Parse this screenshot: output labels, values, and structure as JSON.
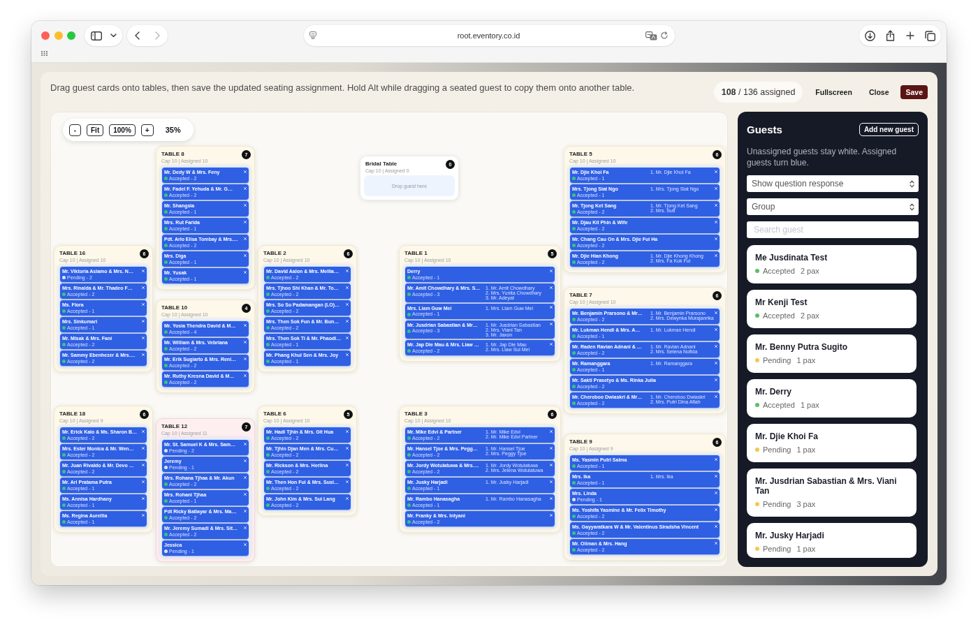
{
  "browser": {
    "url": "root.eventory.co.id"
  },
  "header": {
    "instructions": "Drag guest cards onto tables, then save the updated seating assignment. Hold Alt while dragging a seated guest to copy them onto another table.",
    "assigned": "**108** / 136 assigned",
    "fullscreen": "Fullscreen",
    "close": "Close",
    "save": "Save"
  },
  "canvas": {
    "zoom_out": "-",
    "fit": "Fit",
    "reset_zoom": "100%",
    "zoom_in": "+",
    "zoom_level": "35%",
    "tables": [
      {
        "name": "TABLE 8",
        "info": "Cap 10 | Assigned 10",
        "count": "7",
        "over_capacity": false,
        "guests": [
          {
            "name": "Mr. Dedy W & Mrs. Feny",
            "status": "Accepted - 2",
            "color": "#34c77b"
          },
          {
            "name": "Mr. Fadel F. Yehuda & Mr. G…",
            "status": "Accepted - 2",
            "color": "#34c77b"
          },
          {
            "name": "Mr. Shangsia",
            "status": "Accepted - 1",
            "color": "#34c77b"
          },
          {
            "name": "Mrs. Rut Farida",
            "status": "Accepted - 1",
            "color": "#34c77b"
          },
          {
            "name": "Pdt. Arlo Elisa Tombay & Mrs.…",
            "status": "Accepted - 2",
            "color": "#34c77b"
          },
          {
            "name": "Mrs. Diga",
            "status": "Accepted - 1",
            "color": "#34c77b"
          },
          {
            "name": "Mr. Yusak",
            "status": "Accepted - 1",
            "color": "#34c77b"
          }
        ]
      },
      {
        "name": "Bridal Table",
        "info": "Cap 10 | Assigned 0",
        "count": "0",
        "over_capacity": false,
        "drop_hint": "Drop guest here"
      },
      {
        "name": "TABLE 5",
        "info": "Cap 10 | Assigned 10",
        "count": "6",
        "over_capacity": false,
        "guests": [
          {
            "name": "Mr. Djie Khoi Fa",
            "status": "Accepted - 1",
            "color": "#34c77b",
            "members": [
              "1. Mr. Djie Khoi Fa"
            ]
          },
          {
            "name": "Mrs. Tjong Siat Ngo",
            "status": "Accepted - 1",
            "color": "#34c77b",
            "members": [
              "1. Mrs. Tjong Siat Ngo"
            ]
          },
          {
            "name": "Mr. Tjong Ket Sang",
            "status": "Accepted - 2",
            "color": "#34c77b",
            "members": [
              "1. Mr. Tjong Ket Sang",
              "2. Mrs. Sufi"
            ]
          },
          {
            "name": "Mr. Djau Kit Phin & Wife",
            "status": "Accepted - 2",
            "color": "#34c77b"
          },
          {
            "name": "Mr. Chang Cau On & Mrs. Djie Fui Ha",
            "status": "Accepted - 2",
            "color": "#34c77b"
          },
          {
            "name": "Mr. Djie Hian Khong",
            "status": "Accepted - 2",
            "color": "#34c77b",
            "members": [
              "1. Mr. Djie Khong Khong",
              "2. Mrs. Fa Kok Fui"
            ]
          }
        ]
      },
      {
        "name": "TABLE 16",
        "info": "Cap 10 | Assigned 10",
        "count": "6",
        "over_capacity": false,
        "guests": [
          {
            "name": "Mr. Viktoria Asiamo & Mrs. N…",
            "status": "Pending - 2",
            "color": "#dfe3ea"
          },
          {
            "name": "Mrs. Rinalda & Mr. Thadeo F…",
            "status": "Accepted - 2",
            "color": "#34c77b"
          },
          {
            "name": "Ms. Flora",
            "status": "Accepted - 1",
            "color": "#34c77b"
          },
          {
            "name": "Mrs. Sinkumari",
            "status": "Accepted - 1",
            "color": "#34c77b"
          },
          {
            "name": "Mr. Misak & Mrs. Fani",
            "status": "Accepted - 2",
            "color": "#34c77b"
          },
          {
            "name": "Mr. Sammy Ebenhezer & Mrs.…",
            "status": "Accepted - 2",
            "color": "#34c77b"
          }
        ]
      },
      {
        "name": "TABLE 2",
        "info": "Cap 10 | Assigned 10",
        "count": "6",
        "over_capacity": false,
        "guests": [
          {
            "name": "Mr. David Aalon & Mrs. Mellia…",
            "status": "Accepted - 2",
            "color": "#34c77b"
          },
          {
            "name": "Mrs. Tjhoo Shi Khan & Mr. To…",
            "status": "Accepted - 2",
            "color": "#34c77b"
          },
          {
            "name": "Mrs. So So Padamangan (LO)…",
            "status": "Accepted - 2",
            "color": "#34c77b"
          },
          {
            "name": "Mrs. Then Sok Fun & Mr. Bun…",
            "status": "Accepted - 2",
            "color": "#34c77b"
          },
          {
            "name": "Mrs. Then Sok Ti & Mr. Phaodi…",
            "status": "Accepted - 1",
            "color": "#34c77b"
          },
          {
            "name": "Mr. Phang Khui Sen & Mrs. Joy",
            "status": "Accepted - 1",
            "color": "#34c77b"
          }
        ]
      },
      {
        "name": "TABLE 1",
        "info": "Cap 10 | Assigned 10",
        "count": "5",
        "over_capacity": false,
        "guests": [
          {
            "name": "Derry",
            "status": "Accepted - 1",
            "color": "#34c77b"
          },
          {
            "name": "Mr. Amit Chowdhary & Mrs. S…",
            "status": "Accepted - 3",
            "color": "#34c77b",
            "members": [
              "1. Mr. Amit Chowdhary",
              "2. Mrs. Yunita Chowdhary",
              "3. Mr. Adeyat"
            ]
          },
          {
            "name": "Mrs. Liam Guw Mei",
            "status": "Accepted - 1",
            "color": "#34c77b",
            "members": [
              "1. Mrs. Liam Guw Mei"
            ]
          },
          {
            "name": "Mr. Jusdrian Sabastian & Mr…",
            "status": "Accepted - 3",
            "color": "#34c77b",
            "members": [
              "1. Mr. Jusdrian Sabastian",
              "2. Mrs. Viani Tan",
              "3. Mr. Jaxon"
            ]
          },
          {
            "name": "Mr. Jap Die Mau & Mrs. Liaw …",
            "status": "Accepted - 2",
            "color": "#34c77b",
            "members": [
              "1. Mr. Jap Die Mau",
              "2. Mrs. Liaw Sui Mei"
            ]
          }
        ]
      },
      {
        "name": "TABLE 10",
        "info": "Cap 10 | Assigned 10",
        "count": "4",
        "over_capacity": false,
        "guests": [
          {
            "name": "Mr. Yosia Thendra David & M…",
            "status": "Accepted - 4",
            "color": "#34c77b"
          },
          {
            "name": "Mr. William & Mrs. Vebriana",
            "status": "Accepted - 2",
            "color": "#34c77b"
          },
          {
            "name": "Mr. Erik Sugiarto & Mrs. Reni…",
            "status": "Accepted - 2",
            "color": "#34c77b"
          },
          {
            "name": "Mr. Ruthy Kresna David & M…",
            "status": "Accepted - 2",
            "color": "#34c77b"
          }
        ]
      },
      {
        "name": "TABLE 7",
        "info": "Cap 10 | Assigned 10",
        "count": "6",
        "over_capacity": false,
        "guests": [
          {
            "name": "Mr. Benjamin Prarsono & Mr…",
            "status": "Accepted - 2",
            "color": "#34c77b",
            "members": [
              "1. Mr. Benjamin Prarsono",
              "2. Mrs. Dewynka Murajanrika"
            ]
          },
          {
            "name": "Mr. Lukman Hendi & Mrs. A…",
            "status": "Accepted - 1",
            "color": "#34c77b",
            "members": [
              "1. Mr. Lukman Hendi"
            ]
          },
          {
            "name": "Mr. Raden Ravian Adnani & …",
            "status": "Accepted - 2",
            "color": "#34c77b",
            "members": [
              "1. Mr. Ravian Adnani",
              "2. Mrs. Selena Nofida"
            ]
          },
          {
            "name": "Mr. Ramanggara",
            "status": "Accepted - 1",
            "color": "#34c77b",
            "members": [
              "1. Mr. Ramanggara"
            ]
          },
          {
            "name": "Mr. Sakti Prasetyo & Ms. Rinka Julia",
            "status": "Accepted - 2",
            "color": "#34c77b"
          },
          {
            "name": "Mr. Cheroboo Dwiaskri & Mr…",
            "status": "Accepted - 2",
            "color": "#34c77b",
            "members": [
              "1. Mr. Cheroboo Dwiaskri",
              "2. Mrs. Putri Dina Aflah"
            ]
          }
        ]
      },
      {
        "name": "TABLE 18",
        "info": "Cap 10 | Assigned 9",
        "count": "6",
        "over_capacity": false,
        "guests": [
          {
            "name": "Mr. Erick Kalo & Ms. Sharon B…",
            "status": "Accepted - 2",
            "color": "#34c77b"
          },
          {
            "name": "Mrs. Ester Monica & Mr. Wen…",
            "status": "Accepted - 2",
            "color": "#34c77b"
          },
          {
            "name": "Mr. Juan Rivaldo & Mr. Devo …",
            "status": "Accepted - 2",
            "color": "#34c77b"
          },
          {
            "name": "Mr. Ari Pratama Putra",
            "status": "Accepted - 1",
            "color": "#34c77b"
          },
          {
            "name": "Ms. Annisa Hardhany",
            "status": "Accepted - 1",
            "color": "#34c77b"
          },
          {
            "name": "Ms. Regina Aurellia",
            "status": "Accepted - 1",
            "color": "#34c77b"
          }
        ]
      },
      {
        "name": "TABLE 6",
        "info": "Cap 10 | Assigned 10",
        "count": "5",
        "over_capacity": false,
        "guests": [
          {
            "name": "Mr. Hadi Tjhin & Mrs. Git Hua",
            "status": "Accepted - 2",
            "color": "#34c77b"
          },
          {
            "name": "Mr. Tjhin Djan Men & Mrs. Cu…",
            "status": "Accepted - 2",
            "color": "#34c77b"
          },
          {
            "name": "Mr. Rickson & Mrs. Herlina",
            "status": "Accepted - 2",
            "color": "#34c77b"
          },
          {
            "name": "Mr. Then Hon Fui & Mrs. Susi…",
            "status": "Accepted - 2",
            "color": "#34c77b"
          },
          {
            "name": "Mr. John Kim & Mrs. Sui Lang",
            "status": "Accepted - 2",
            "color": "#34c77b"
          }
        ]
      },
      {
        "name": "TABLE 3",
        "info": "Cap 10 | Assigned 10",
        "count": "6",
        "over_capacity": false,
        "guests": [
          {
            "name": "Mr. Mike Edvi & Partner",
            "status": "Accepted - 2",
            "color": "#34c77b",
            "members": [
              "1. Mr. Mike Edvi",
              "2. Mr. Mike Edvi Partner"
            ]
          },
          {
            "name": "Mr. Hansel Tjoe & Mrs. Pegg…",
            "status": "Accepted - 2",
            "color": "#34c77b",
            "members": [
              "1. Mr. Hansel Tjoe",
              "2. Mrs. Peggy Tjoe"
            ]
          },
          {
            "name": "Mr. Jordy Wotulatuwa & Mrs.…",
            "status": "Accepted - 2",
            "color": "#34c77b",
            "members": [
              "1. Mr. Jordy Wotulatuwa",
              "2. Mrs. Jelena Wotulatuwa"
            ]
          },
          {
            "name": "Mr. Jusky Harjadi",
            "status": "Accepted - 1",
            "color": "#34c77b",
            "members": [
              "1. Mr. Jusky Harjadi"
            ]
          },
          {
            "name": "Mr. Rambo Hanasagha",
            "status": "Accepted - 1",
            "color": "#34c77b",
            "members": [
              "1. Mr. Rambo Hanasagha"
            ]
          },
          {
            "name": "Mr. Franky & Mrs. Intyani",
            "status": "Accepted - 2",
            "color": "#34c77b"
          }
        ]
      },
      {
        "name": "TABLE 12",
        "info": "Cap 10 | Assigned 11",
        "count": "7",
        "over_capacity": true,
        "guests": [
          {
            "name": "Mr. St. Samuel K & Mrs. Sam…",
            "status": "Pending - 2",
            "color": "#dfe3ea"
          },
          {
            "name": "Jeremy",
            "status": "Pending - 1",
            "color": "#dfe3ea"
          },
          {
            "name": "Mrs. Rohana Tjhaa & Mr. Akun",
            "status": "Accepted - 2",
            "color": "#34c77b"
          },
          {
            "name": "Mrs. Rohani Tjhaa",
            "status": "Accepted - 1",
            "color": "#34c77b"
          },
          {
            "name": "Pdt Ricky Batlayar & Mrs. Ma…",
            "status": "Accepted - 2",
            "color": "#34c77b"
          },
          {
            "name": "Mr. Jeremy Sumadi & Mrs. Sit…",
            "status": "Accepted - 2",
            "color": "#34c77b"
          },
          {
            "name": "Jessica",
            "status": "Pending - 1",
            "color": "#dfe3ea"
          }
        ]
      },
      {
        "name": "TABLE 9",
        "info": "Cap 10 | Assigned 9",
        "count": "6",
        "over_capacity": false,
        "guests": [
          {
            "name": "Ms. Yasmin Putri Salma",
            "status": "Accepted - 1",
            "color": "#34c77b"
          },
          {
            "name": "Mrs. Ika",
            "status": "Accepted - 1",
            "color": "#34c77b",
            "members": [
              "1. Mrs. Ika"
            ]
          },
          {
            "name": "Mrs. Linda",
            "status": "Pending - 1",
            "color": "#dfe3ea"
          },
          {
            "name": "Ms. Yoshifa Yasmine & Mr. Felix Timothy",
            "status": "Accepted - 2",
            "color": "#34c77b"
          },
          {
            "name": "Ms. Gayyaratkara W & Mr. Valentinus Siradsha Vincent",
            "status": "Accepted - 2",
            "color": "#34c77b"
          },
          {
            "name": "Mr. Oliman & Mrs. Hang",
            "status": "Accepted - 2",
            "color": "#34c77b"
          }
        ]
      }
    ]
  },
  "sidebar": {
    "title": "Guests",
    "add_guest": "Add new guest",
    "hint": "Unassigned guests stay white. Assigned guests turn blue.",
    "question_select": "Show question response",
    "group_select": "Group",
    "search": {
      "placeholder": "Search guest"
    },
    "guests": [
      {
        "name": "Me Jusdinata Test",
        "status": "Accepted",
        "pax": "2 pax",
        "color": "#5bbf6a"
      },
      {
        "name": "Mr Kenji Test",
        "status": "Accepted",
        "pax": "2 pax",
        "color": "#5bbf6a"
      },
      {
        "name": "Mr. Benny Putra Sugito",
        "status": "Pending",
        "pax": "1 pax",
        "color": "#f2c94c"
      },
      {
        "name": "Mr. Derry",
        "status": "Accepted",
        "pax": "1 pax",
        "color": "#5bbf6a"
      },
      {
        "name": "Mr. Djie Khoi Fa",
        "status": "Pending",
        "pax": "1 pax",
        "color": "#f2c94c"
      },
      {
        "name": "Mr. Jusdrian Sabastian & Mrs. Viani Tan",
        "status": "Pending",
        "pax": "3 pax",
        "color": "#f2c94c"
      },
      {
        "name": "Mr. Jusky Harjadi",
        "status": "Pending",
        "pax": "1 pax",
        "color": "#f2c94c"
      }
    ]
  }
}
